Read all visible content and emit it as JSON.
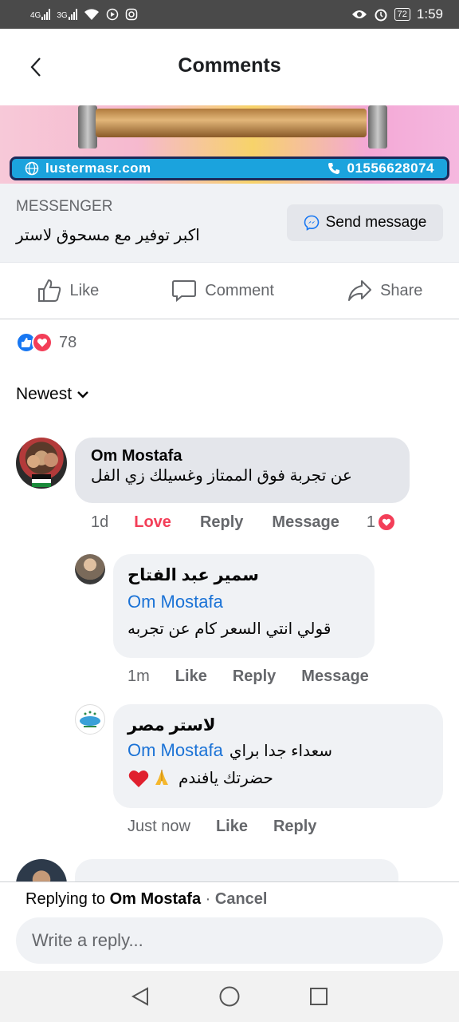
{
  "status_bar": {
    "network1": "4G",
    "network2": "3G",
    "battery": "72",
    "time": "1:59"
  },
  "header": {
    "title": "Comments"
  },
  "ad": {
    "website": "lustermasr.com",
    "phone": "01556628074"
  },
  "cta": {
    "source": "MESSENGER",
    "text": "اكبر توفير مع مسحوق لاستر",
    "button_label": "Send message"
  },
  "actions": {
    "like": "Like",
    "comment": "Comment",
    "share": "Share"
  },
  "reactions": {
    "count": "78"
  },
  "sort": {
    "label": "Newest"
  },
  "comments": [
    {
      "author": "Om Mostafa",
      "text": "عن تجربة فوق الممتاز وغسيلك زي الفل",
      "time": "1d",
      "reaction_label": "Love",
      "reply": "Reply",
      "message": "Message",
      "reaction_count": "1",
      "replies": [
        {
          "author": "سمير عبد الفتاح",
          "mention": "Om Mostafa",
          "text": "قولي انتي السعر كام عن تجربه",
          "time": "1m",
          "like": "Like",
          "reply": "Reply",
          "message": "Message"
        },
        {
          "author": "لاستر مصر",
          "mention": "Om Mostafa",
          "text_line1": "سعداء جدا براي",
          "text_line2": "حضرتك يافندم",
          "time": "Just now",
          "like": "Like",
          "reply": "Reply"
        }
      ]
    }
  ],
  "reply_bar": {
    "prefix": "Replying to",
    "name": "Om Mostafa",
    "separator": "·",
    "cancel": "Cancel",
    "placeholder": "Write a reply..."
  },
  "colors": {
    "link": "#1a72d6",
    "love": "#f33e58",
    "like": "#1877f2",
    "muted": "#65676b",
    "bubble": "#e4e6eb"
  }
}
